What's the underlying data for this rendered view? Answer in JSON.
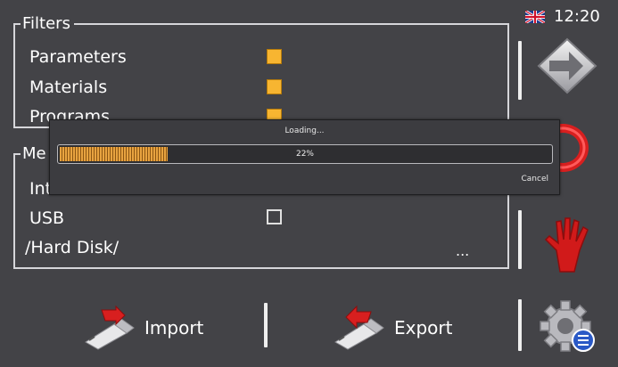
{
  "status": {
    "time": "12:20",
    "language_flag": "uk-flag-icon"
  },
  "filters": {
    "title": "Filters",
    "items": [
      {
        "label": "Parameters",
        "checked": true
      },
      {
        "label": "Materials",
        "checked": true
      },
      {
        "label": "Programs",
        "checked": true
      }
    ]
  },
  "media": {
    "title": "Me",
    "items": [
      {
        "label": "Int",
        "checked": false
      },
      {
        "label": "USB",
        "checked": false
      }
    ],
    "path": "/Hard Disk/",
    "browse_label": "..."
  },
  "side_buttons": [
    {
      "name": "next-arrow-icon"
    },
    {
      "name": "loop-icon"
    },
    {
      "name": "hand-icon"
    }
  ],
  "bottom": {
    "import_label": "Import",
    "export_label": "Export",
    "settings_icon": "settings-gear-icon"
  },
  "dialog": {
    "title": "Loading...",
    "progress_text": "22%",
    "progress_value": 0.22,
    "cancel_label": "Cancel"
  },
  "colors": {
    "background": "#434347",
    "checkbox_on": "#f7b531",
    "progress_fill": "#e8a340"
  }
}
